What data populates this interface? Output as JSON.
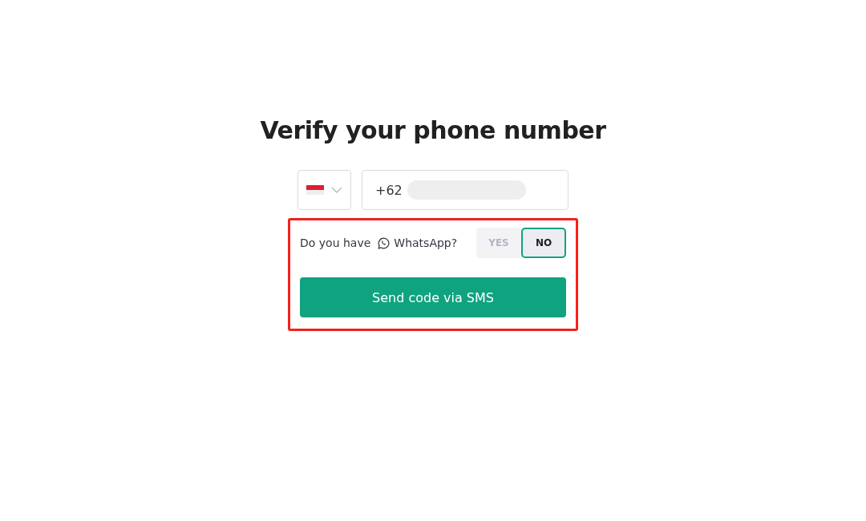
{
  "title": "Verify your phone number",
  "phone": {
    "value": "+62"
  },
  "whatsapp": {
    "prompt": "Do you have",
    "name": "WhatsApp?",
    "options": [
      {
        "label": "YES",
        "selected": false
      },
      {
        "label": "NO",
        "selected": true
      }
    ]
  },
  "button": "Send code via SMS"
}
